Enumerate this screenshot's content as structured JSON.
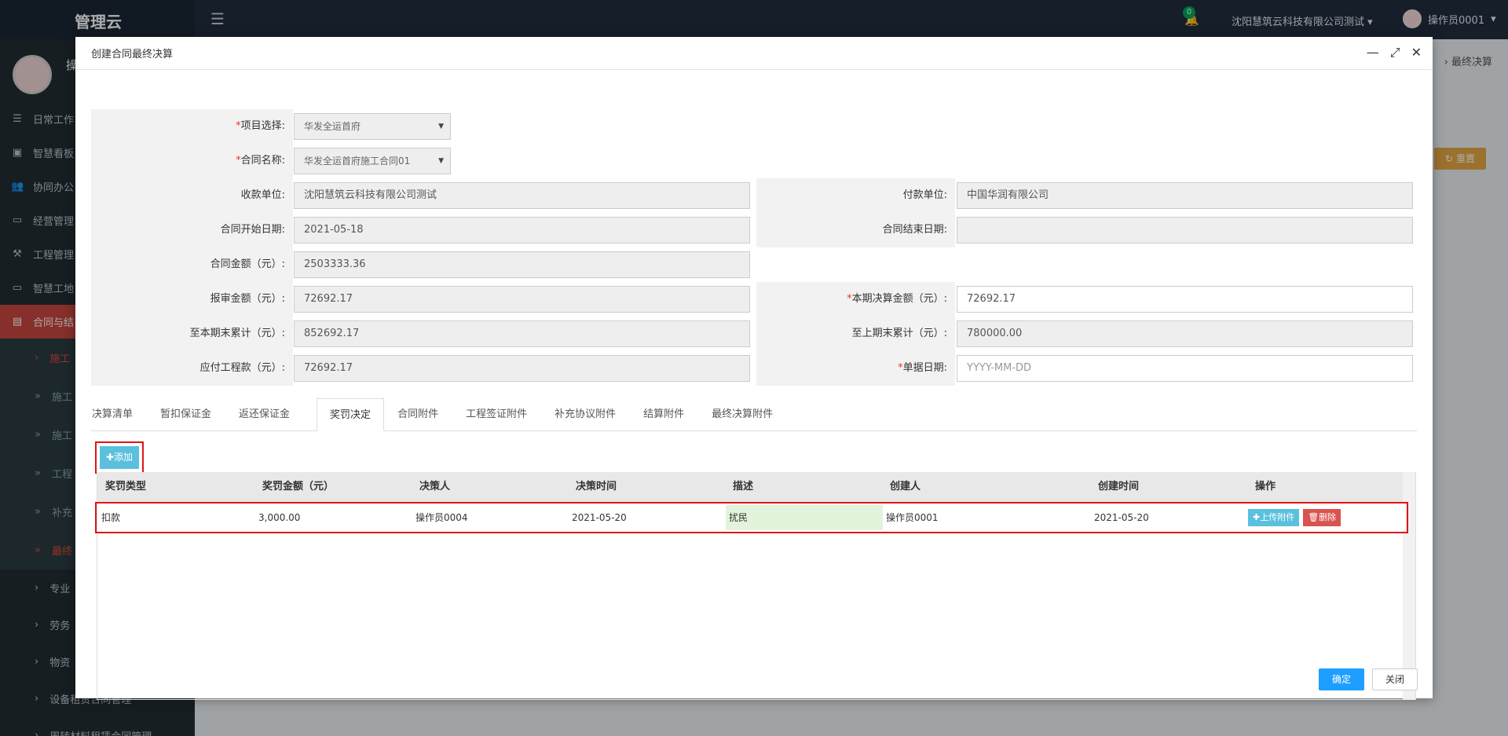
{
  "app": {
    "logo": "管理云",
    "notification_count": "0",
    "company": "沈阳慧筑云科技有限公司测试",
    "user": "操作员0001",
    "breadcrumb_tail": "最终决算",
    "reset_label": "重置"
  },
  "sidebar": {
    "user_name": "操",
    "items": [
      {
        "label": "日常工作"
      },
      {
        "label": "智慧看板"
      },
      {
        "label": "协同办公"
      },
      {
        "label": "经营管理"
      },
      {
        "label": "工程管理"
      },
      {
        "label": "智慧工地"
      },
      {
        "label": "合同与结"
      }
    ],
    "sub_items": [
      {
        "label": "施工"
      },
      {
        "label": "施工"
      },
      {
        "label": "施工"
      },
      {
        "label": "工程"
      },
      {
        "label": "补充"
      },
      {
        "label": "最终"
      },
      {
        "label": "专业"
      },
      {
        "label": "劳务"
      },
      {
        "label": "物资"
      },
      {
        "label": "设备租赁合同管理"
      },
      {
        "label": "周转材料租赁合同管理"
      }
    ]
  },
  "modal": {
    "title": "创建合同最终决算",
    "form": {
      "project": {
        "label": "项目选择:",
        "value": "华发全运首府"
      },
      "contract_name": {
        "label": "合同名称:",
        "value": "华发全运首府施工合同01"
      },
      "payee": {
        "label": "收款单位:",
        "value": "沈阳慧筑云科技有限公司测试"
      },
      "payer": {
        "label": "付款单位:",
        "value": "中国华润有限公司"
      },
      "start_date": {
        "label": "合同开始日期:",
        "value": "2021-05-18"
      },
      "end_date": {
        "label": "合同结束日期:",
        "value": ""
      },
      "contract_amount": {
        "label": "合同金额（元）:",
        "value": "2503333.36"
      },
      "reported_amount": {
        "label": "报审金额（元）:",
        "value": "72692.17"
      },
      "current_settlement": {
        "label": "本期决算金额（元）:",
        "value": "72692.17"
      },
      "cumulative_to_now": {
        "label": "至本期末累计（元）:",
        "value": "852692.17"
      },
      "cumulative_prev": {
        "label": "至上期末累计（元）:",
        "value": "780000.00"
      },
      "payable": {
        "label": "应付工程款（元）:",
        "value": "72692.17"
      },
      "doc_date": {
        "label": "单据日期:",
        "placeholder": "YYYY-MM-DD"
      }
    },
    "tabs": [
      {
        "label": "决算清单"
      },
      {
        "label": "暂扣保证金"
      },
      {
        "label": "返还保证金"
      },
      {
        "label": "奖罚决定"
      },
      {
        "label": "合同附件"
      },
      {
        "label": "工程签证附件"
      },
      {
        "label": "补充协议附件"
      },
      {
        "label": "结算附件"
      },
      {
        "label": "最终决算附件"
      }
    ],
    "active_tab": "奖罚决定",
    "add_label": "添加",
    "grid": {
      "headers": [
        "奖罚类型",
        "奖罚金额（元）",
        "决策人",
        "决策时间",
        "描述",
        "创建人",
        "创建时间",
        "操作"
      ],
      "rows": [
        {
          "type": "扣款",
          "amount": "3,000.00",
          "decider": "操作员0004",
          "decision_time": "2021-05-20",
          "description": "扰民",
          "creator": "操作员0001",
          "created_time": "2021-05-20",
          "upload_label": "上传附件",
          "delete_label": "删除"
        }
      ]
    },
    "ok_label": "确定",
    "close_label": "关闭"
  }
}
